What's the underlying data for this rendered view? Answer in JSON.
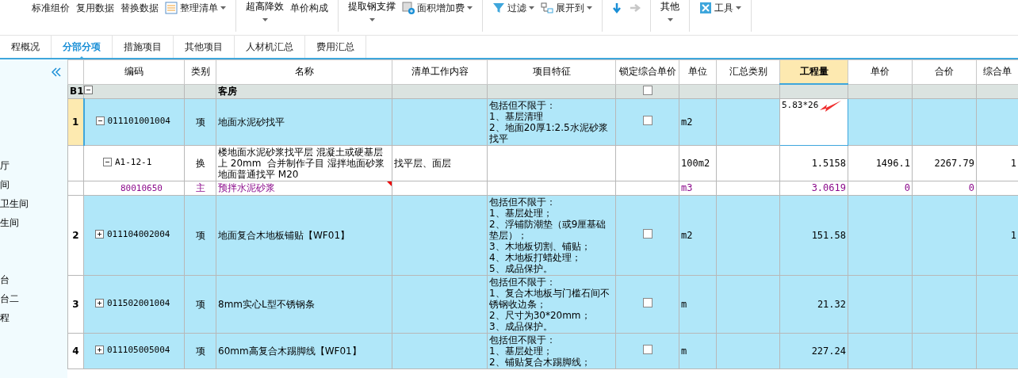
{
  "toolbar": [
    {
      "kind": "text",
      "label": "标准组价"
    },
    {
      "kind": "text",
      "label": "复用数据"
    },
    {
      "kind": "text",
      "label": "替换数据"
    },
    {
      "kind": "icon-menu",
      "label": "整理清单"
    },
    {
      "kind": "separator"
    },
    {
      "kind": "stack",
      "label": "超高降效"
    },
    {
      "kind": "text",
      "label": "单价构成"
    },
    {
      "kind": "separator"
    },
    {
      "kind": "stack",
      "label": "提取钢支撑"
    },
    {
      "kind": "icon-menu",
      "label": "面积增加费"
    },
    {
      "kind": "separator"
    },
    {
      "kind": "icon-menu",
      "label": "过滤"
    },
    {
      "kind": "icon-menu",
      "label": "展开到"
    },
    {
      "kind": "separator"
    },
    {
      "kind": "down-arrow",
      "disabled": false
    },
    {
      "kind": "right-arrow",
      "disabled": true
    },
    {
      "kind": "separator"
    },
    {
      "kind": "stack",
      "label": "其他"
    },
    {
      "kind": "separator"
    },
    {
      "kind": "icon-menu",
      "label": "工具"
    },
    {
      "kind": "separator"
    }
  ],
  "tabs": [
    {
      "label": "程概况",
      "selected": false
    },
    {
      "label": "分部分项",
      "selected": true
    },
    {
      "label": "措施项目",
      "selected": false
    },
    {
      "label": "其他项目",
      "selected": false
    },
    {
      "label": "人材机汇总",
      "selected": false
    },
    {
      "label": "费用汇总",
      "selected": false
    }
  ],
  "sidebar": {
    "items": [
      {
        "label": "厅"
      },
      {
        "label": "间"
      },
      {
        "label": "卫生间"
      },
      {
        "label": "生间"
      },
      {
        "label": "台"
      },
      {
        "label": "台二"
      },
      {
        "label": "程"
      }
    ]
  },
  "table": {
    "columns": [
      {
        "label": "编码",
        "selected": false
      },
      {
        "label": "类别",
        "selected": false
      },
      {
        "label": "名称",
        "selected": false
      },
      {
        "label": "清单工作内容",
        "selected": false
      },
      {
        "label": "项目特征",
        "selected": false
      },
      {
        "label": "锁定综合单价",
        "selected": false
      },
      {
        "label": "单位",
        "selected": false
      },
      {
        "label": "汇总类别",
        "selected": false
      },
      {
        "label": "工程量",
        "selected": true
      },
      {
        "label": "单价",
        "selected": false
      },
      {
        "label": "合价",
        "selected": false
      },
      {
        "label": "综合单",
        "selected": false
      }
    ],
    "rows": [
      {
        "kind": "section",
        "num": "B1",
        "expanded": true,
        "name": "客房",
        "lock": false,
        "selected": false
      },
      {
        "kind": "item",
        "num": "1",
        "selected": true,
        "expanded": true,
        "code": "011101001004",
        "type": "项",
        "name": "地面水泥砂找平",
        "features": "包括但不限于：\n1、基层清理\n2、地面20厚1:2.5水泥砂浆找平",
        "lock": false,
        "unit": "m2",
        "qty": "5.83*26",
        "editing": true
      },
      {
        "kind": "sub",
        "selected": false,
        "expanded": true,
        "code": "A1-12-1",
        "type": "换",
        "name": "楼地面水泥砂浆找平层 混凝土或硬基层上 20mm  合并制作子目 湿拌地面砂浆地面普通找平 M20",
        "work": "找平层、面层",
        "unit": "100m2",
        "qty": "1.5158",
        "price": "1496.1",
        "total": "2267.79",
        "extra": "1"
      },
      {
        "kind": "material",
        "selected": false,
        "code": "80010650",
        "type": "主",
        "name": "预拌水泥砂浆",
        "has_note": true,
        "unit": "m3",
        "qty": "3.0619",
        "price": "0",
        "total": "0"
      },
      {
        "kind": "item",
        "num": "2",
        "selected": false,
        "expanded": false,
        "code": "011104002004",
        "type": "项",
        "name": "地面复合木地板铺贴【WF01】",
        "features": "包括但不限于：\n1、基层处理；\n2、浮铺防潮垫（或9厘基础垫层）；\n3、木地板切割、铺贴；\n4、木地板打蜡处理；\n5、成品保护。",
        "lock": false,
        "unit": "m2",
        "qty": "151.58",
        "extra": "1"
      },
      {
        "kind": "item",
        "num": "3",
        "selected": false,
        "expanded": false,
        "code": "011502001004",
        "type": "项",
        "name": "8mm实心L型不锈钢条",
        "features": "包括但不限于：\n1、复合木地板与门槛石间不锈钢收边条；\n2、尺寸为30*20mm；\n3、成品保护。",
        "lock": false,
        "unit": "m",
        "qty": "21.32"
      },
      {
        "kind": "item",
        "num": "4",
        "selected": false,
        "expanded": false,
        "code": "011105005004",
        "type": "项",
        "name": "60mm高复合木踢脚线【WF01】",
        "features": "包括但不限于：\n1、基层处理；\n2、铺贴复合木踢脚线；",
        "lock": false,
        "unit": "m",
        "qty": "227.24"
      }
    ]
  }
}
